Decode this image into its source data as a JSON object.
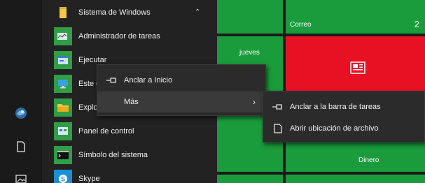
{
  "group": {
    "label": "Sistema de Windows"
  },
  "apps": [
    {
      "label": "Administrador de tareas",
      "icon": "task-manager-icon"
    },
    {
      "label": "Ejecutar",
      "icon": "run-icon"
    },
    {
      "label": "Este e",
      "icon": "this-pc-icon"
    },
    {
      "label": "Explo",
      "icon": "file-explorer-icon"
    },
    {
      "label": "Panel de control",
      "icon": "control-panel-icon"
    },
    {
      "label": "Símbolo del sistema",
      "icon": "command-prompt-icon"
    },
    {
      "label": "Skype",
      "icon": "skype-icon"
    }
  ],
  "tiles": {
    "correo": {
      "label": "Correo",
      "badge": "2"
    },
    "calendar": {
      "label": "jueves"
    },
    "dinero": {
      "label": "Dinero"
    }
  },
  "context_menu": {
    "items": [
      {
        "label": "Anclar a Inicio",
        "icon": "pin-icon"
      },
      {
        "label": "Más",
        "icon": ""
      }
    ]
  },
  "submenu": {
    "items": [
      {
        "label": "Anclar a la barra de tareas",
        "icon": "pin-icon"
      },
      {
        "label": "Abrir ubicación de archivo",
        "icon": "document-icon"
      }
    ]
  },
  "colors": {
    "green_tile": "#1a9c3c",
    "red_tile": "#e81123",
    "menu_bg": "#2b2b2b"
  }
}
